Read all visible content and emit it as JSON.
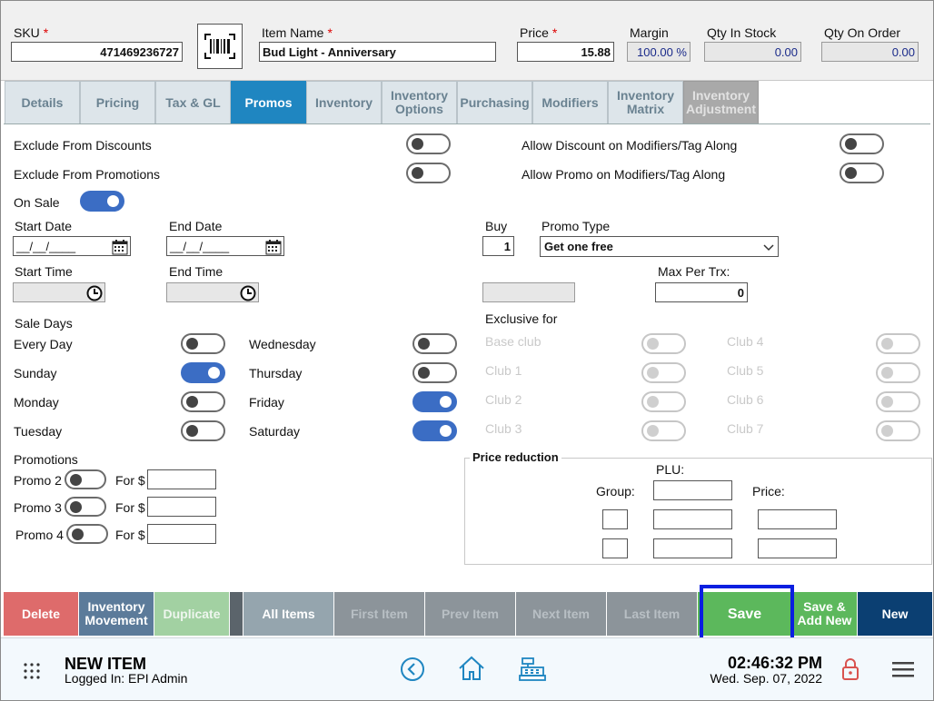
{
  "header": {
    "sku_label": "SKU",
    "sku_value": "471469236727",
    "item_name_label": "Item Name",
    "item_name_value": "Bud Light - Anniversary",
    "price_label": "Price",
    "price_value": "15.88",
    "margin_label": "Margin",
    "margin_value": "100.00 %",
    "qty_in_stock_label": "Qty In Stock",
    "qty_in_stock_value": "0.00",
    "qty_on_order_label": "Qty On Order",
    "qty_on_order_value": "0.00",
    "required_mark": "*"
  },
  "tabs": [
    {
      "label": "Details",
      "state": "normal"
    },
    {
      "label": "Pricing",
      "state": "normal"
    },
    {
      "label": "Tax & GL",
      "state": "normal"
    },
    {
      "label": "Promos",
      "state": "active"
    },
    {
      "label": "Inventory",
      "state": "normal"
    },
    {
      "label": "Inventory Options",
      "state": "normal"
    },
    {
      "label": "Purchasing",
      "state": "normal"
    },
    {
      "label": "Modifiers",
      "state": "normal"
    },
    {
      "label": "Inventory Matrix",
      "state": "normal"
    },
    {
      "label": "Inventory Adjustment",
      "state": "disabled"
    }
  ],
  "promos": {
    "exclude_discounts_label": "Exclude From Discounts",
    "exclude_discounts_on": false,
    "exclude_promotions_label": "Exclude From Promotions",
    "exclude_promotions_on": false,
    "allow_discount_modifiers_label": "Allow Discount on Modifiers/Tag Along",
    "allow_discount_modifiers_on": false,
    "allow_promo_modifiers_label": "Allow Promo on Modifiers/Tag Along",
    "allow_promo_modifiers_on": false,
    "on_sale_label": "On Sale",
    "on_sale_on": true,
    "start_date_label": "Start Date",
    "start_date_value": "__/__/____",
    "end_date_label": "End Date",
    "end_date_value": "__/__/____",
    "start_time_label": "Start Time",
    "end_time_label": "End Time",
    "buy_label": "Buy",
    "buy_value": "1",
    "promo_type_label": "Promo Type",
    "promo_type_value": "Get one free",
    "max_per_trx_label": "Max Per Trx:",
    "max_per_trx_value": "0",
    "sale_days_label": "Sale Days",
    "days": [
      {
        "label": "Every Day",
        "on": false
      },
      {
        "label": "Sunday",
        "on": true
      },
      {
        "label": "Monday",
        "on": false
      },
      {
        "label": "Tuesday",
        "on": false
      },
      {
        "label": "Wednesday",
        "on": false
      },
      {
        "label": "Thursday",
        "on": false
      },
      {
        "label": "Friday",
        "on": true
      },
      {
        "label": "Saturday",
        "on": true
      }
    ],
    "exclusive_for_label": "Exclusive for",
    "clubs": [
      "Base club",
      "Club 1",
      "Club 2",
      "Club 3",
      "Club 4",
      "Club 5",
      "Club 6",
      "Club 7"
    ],
    "promotions_label": "Promotions",
    "promo_rows": [
      {
        "label": "Promo 2",
        "for_label": "For $",
        "value": ""
      },
      {
        "label": "Promo 3",
        "for_label": "For $",
        "value": ""
      },
      {
        "label": "Promo 4",
        "for_label": "For $",
        "value": ""
      }
    ],
    "price_reduction_label": "Price reduction",
    "plu_label": "PLU:",
    "group_label": "Group:",
    "price_label": "Price:"
  },
  "actions": {
    "delete": "Delete",
    "inventory_movement": "Inventory Movement",
    "duplicate": "Duplicate",
    "all_items": "All Items",
    "first_item": "First Item",
    "prev_item": "Prev Item",
    "next_item": "Next Item",
    "last_item": "Last Item",
    "save": "Save",
    "save_add_new": "Save & Add New",
    "new": "New"
  },
  "footer": {
    "title": "NEW ITEM",
    "logged_in": "Logged In:  EPI Admin",
    "time": "02:46:32 PM",
    "date": "Wed. Sep. 07, 2022"
  },
  "colors": {
    "accent": "#1f86c1",
    "toggle_on": "#3b6dc4",
    "delete": "#de6b6b",
    "save": "#5cb85c",
    "new": "#0b3f72",
    "focus": "#0a1fe0"
  }
}
